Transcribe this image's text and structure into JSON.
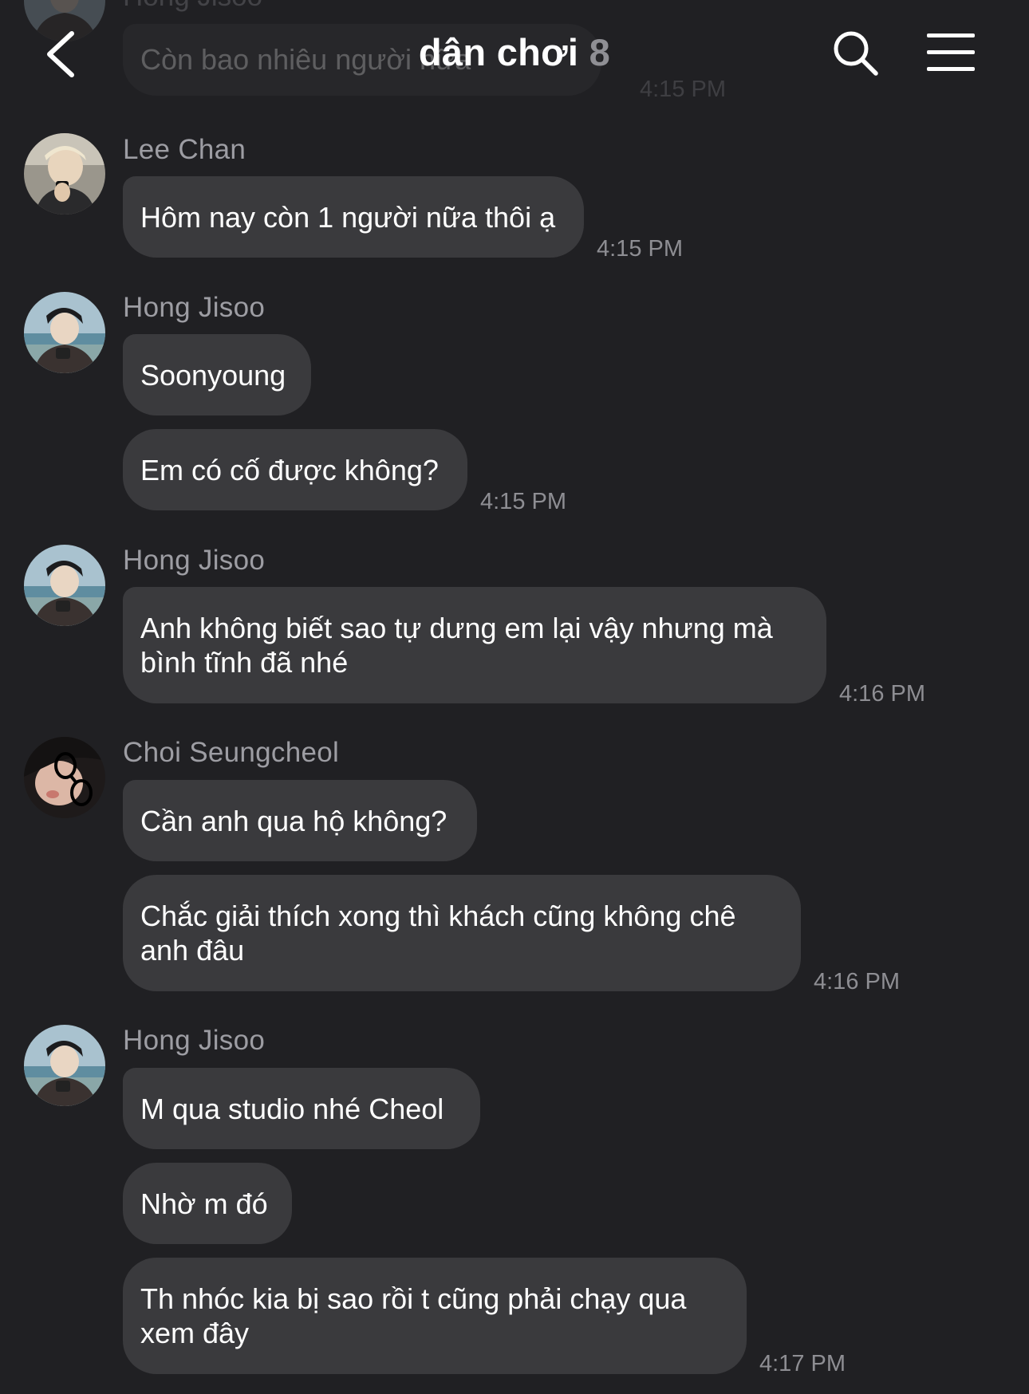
{
  "header": {
    "title": "dân chơi",
    "member_count": "8",
    "back_icon": "chevron-left-icon",
    "search_icon": "search-icon",
    "menu_icon": "hamburger-menu-icon"
  },
  "previous_message": {
    "sender": "Hong Jisoo",
    "text": "Còn bao nhiêu người nữa",
    "time": "4:15 PM"
  },
  "messages": [
    {
      "sender": "Lee Chan",
      "bubbles": [
        "Hôm nay còn 1 người nữa thôi ạ"
      ],
      "time": "4:15 PM"
    },
    {
      "sender": "Hong Jisoo",
      "bubbles": [
        "Soonyoung",
        "Em có cố được không?"
      ],
      "time": "4:15 PM"
    },
    {
      "sender": "Hong Jisoo",
      "bubbles": [
        "Anh không biết sao tự dưng em lại vậy nhưng mà\nbình tĩnh đã nhé"
      ],
      "time": "4:16 PM"
    },
    {
      "sender": "Choi Seungcheol",
      "bubbles": [
        "Cần anh qua hộ không?",
        "Chắc giải thích xong thì khách cũng không chê\nanh đâu"
      ],
      "time": "4:16 PM"
    },
    {
      "sender": "Hong Jisoo",
      "bubbles": [
        "M qua studio nhé Cheol",
        "Nhờ m đó",
        "Th nhóc kia bị sao rồi t cũng phải chạy qua\nxem đây"
      ],
      "time": "4:17 PM"
    }
  ],
  "colors": {
    "background": "#202023",
    "bubble": "#3a3a3d",
    "sender_name": "#9d9da3",
    "timestamp": "#8e8e93",
    "text": "#ffffff"
  }
}
